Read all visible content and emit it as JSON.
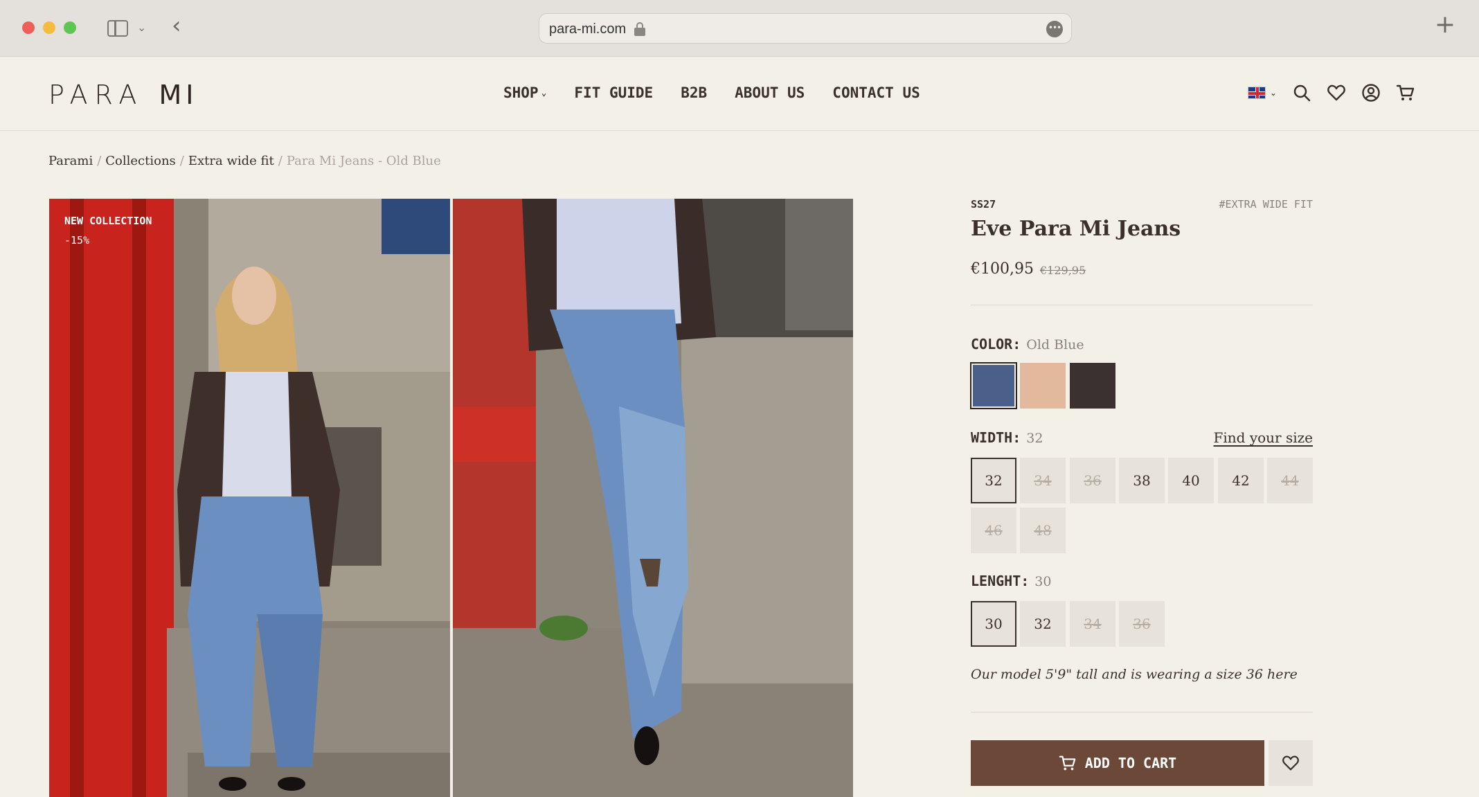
{
  "browser": {
    "url": "para-mi.com",
    "icons": [
      "sidebar-icon",
      "chevron-down-icon",
      "back-chevron-icon",
      "lock-icon",
      "more-icon",
      "plus-icon"
    ],
    "toggle_chevron": "⌄",
    "back_glyph": "‹",
    "more_glyph": "•••",
    "newtab_glyph": "+"
  },
  "header": {
    "logo_left": "PARA",
    "logo_right": "MI",
    "nav": [
      {
        "label": "SHOP",
        "has_dropdown": true
      },
      {
        "label": "FIT GUIDE"
      },
      {
        "label": "B2B"
      },
      {
        "label": "ABOUT US"
      },
      {
        "label": "CONTACT US"
      }
    ],
    "nav_chevron": "⌄",
    "icons": [
      "uk-flag-icon",
      "search-icon",
      "heart-icon",
      "account-icon",
      "cart-icon"
    ]
  },
  "breadcrumb": {
    "items": [
      "Parami",
      "Collections",
      "Extra wide fit"
    ],
    "current": "Para Mi Jeans - Old Blue",
    "separator": "/"
  },
  "gallery": {
    "badge": "NEW COLLECTION",
    "discount": "-15%"
  },
  "product": {
    "season": "SS27",
    "fit_tag": "#EXTRA WIDE FIT",
    "name": "Eve Para Mi Jeans",
    "price": "€100,95",
    "old_price": "€129,95",
    "color_label": "COLOR:",
    "color_value": "Old Blue",
    "colors": [
      {
        "name": "Old Blue",
        "hex": "#4a5f8a",
        "selected": true
      },
      {
        "name": "Beige",
        "hex": "#e3b99e",
        "selected": false
      },
      {
        "name": "Black",
        "hex": "#3a3130",
        "selected": false
      }
    ],
    "width_label": "WIDTH:",
    "width_value": "32",
    "find_size": "Find your size",
    "widths": [
      {
        "size": "32",
        "available": true,
        "selected": true
      },
      {
        "size": "34",
        "available": false
      },
      {
        "size": "36",
        "available": false
      },
      {
        "size": "38",
        "available": true
      },
      {
        "size": "40",
        "available": true
      },
      {
        "size": "42",
        "available": true
      },
      {
        "size": "44",
        "available": false
      },
      {
        "size": "46",
        "available": false
      },
      {
        "size": "48",
        "available": false
      }
    ],
    "length_label": "LENGHT:",
    "length_value": "30",
    "lengths": [
      {
        "size": "30",
        "available": true,
        "selected": true
      },
      {
        "size": "32",
        "available": true
      },
      {
        "size": "34",
        "available": false
      },
      {
        "size": "36",
        "available": false
      }
    ],
    "model_note": "Our model 5'9\" tall and is wearing a size 36 here",
    "add_to_cart": "ADD TO CART"
  }
}
